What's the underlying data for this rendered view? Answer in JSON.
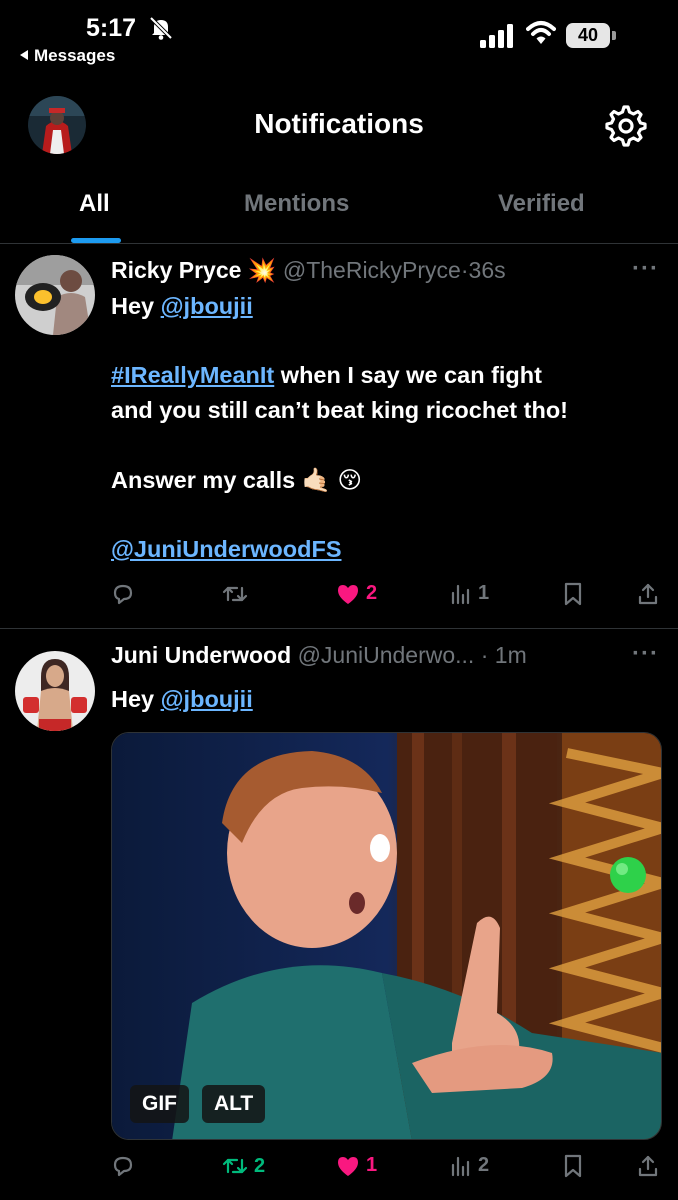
{
  "status_bar": {
    "time": "5:17",
    "back_label": "Messages",
    "battery": "40"
  },
  "header": {
    "title": "Notifications"
  },
  "tabs": [
    {
      "label": "All",
      "active": true
    },
    {
      "label": "Mentions",
      "active": false
    },
    {
      "label": "Verified",
      "active": false
    }
  ],
  "posts": [
    {
      "name": "Ricky Pryce",
      "name_emoji": "💥",
      "handle": "@TheRickyPryce",
      "time": "36s",
      "line1_prefix": "Hey ",
      "line1_mention": "@jboujii",
      "hashtag": "#IReallyMeanIt",
      "line2_rest": " when I say we can fight",
      "line3": "and you still can’t beat king ricochet tho!",
      "line4": "Answer my calls 🤙🏻 😚",
      "line5_mention": "@JuniUnderwoodFS",
      "replies": "",
      "retweets": "",
      "likes": "2",
      "views": "1"
    },
    {
      "name": "Juni Underwood",
      "handle": "@JuniUnderwo...",
      "time": "1m",
      "line1_prefix": "Hey ",
      "line1_mention": "@jboujii",
      "media_badges": [
        "GIF",
        "ALT"
      ],
      "replies": "",
      "retweets": "2",
      "likes": "1",
      "views": "2"
    }
  ],
  "colors": {
    "accent": "#1d9bf0",
    "link": "#6cb6ff",
    "like": "#f91880",
    "retweet": "#00ba7c",
    "muted": "#71767b"
  }
}
